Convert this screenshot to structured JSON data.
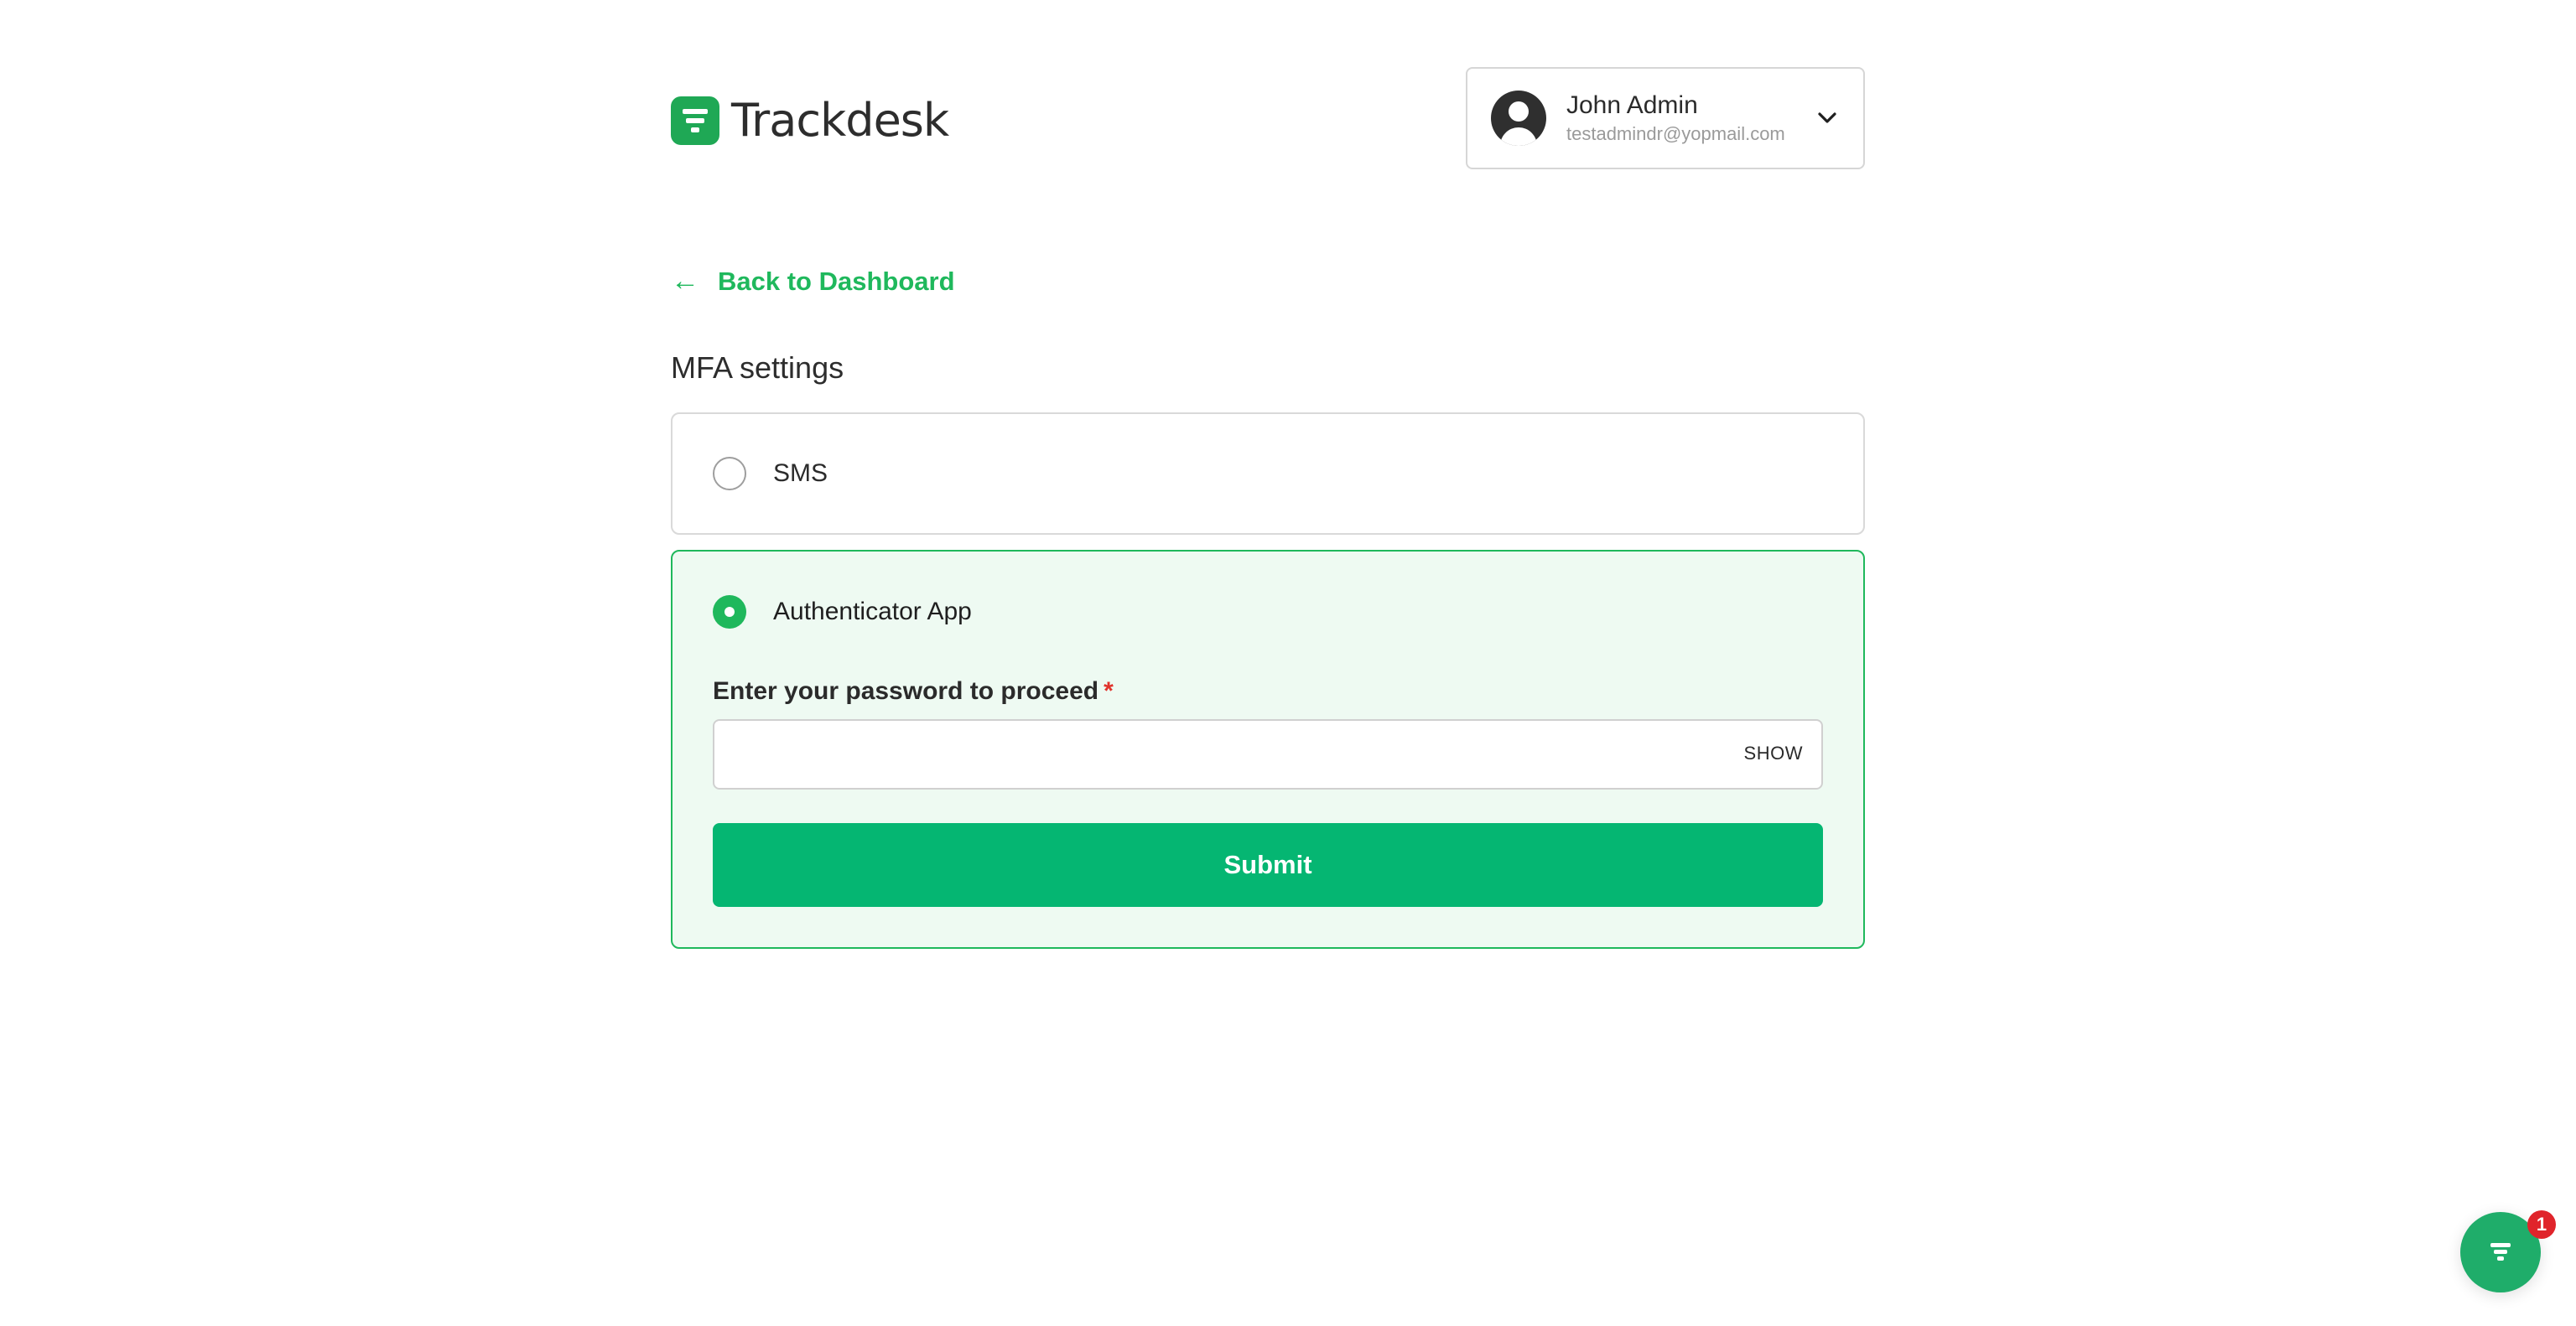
{
  "brand": {
    "name": "Trackdesk",
    "color": "#1fa855"
  },
  "user": {
    "name": "John Admin",
    "email": "testadmindr@yopmail.com"
  },
  "nav": {
    "back_label": "Back to Dashboard",
    "back_arrow": "←"
  },
  "page": {
    "title": "MFA settings"
  },
  "options": [
    {
      "label": "SMS",
      "selected": false
    },
    {
      "label": "Authenticator App",
      "selected": true
    }
  ],
  "form": {
    "password_label": "Enter your password to proceed",
    "required_marker": "*",
    "password_value": "",
    "show_label": "SHOW",
    "submit_label": "Submit"
  },
  "chat": {
    "badge_count": "1"
  },
  "colors": {
    "accent": "#1fb85c",
    "submit": "#05b672",
    "selected_bg": "#eefaf2",
    "badge": "#e0242b"
  }
}
